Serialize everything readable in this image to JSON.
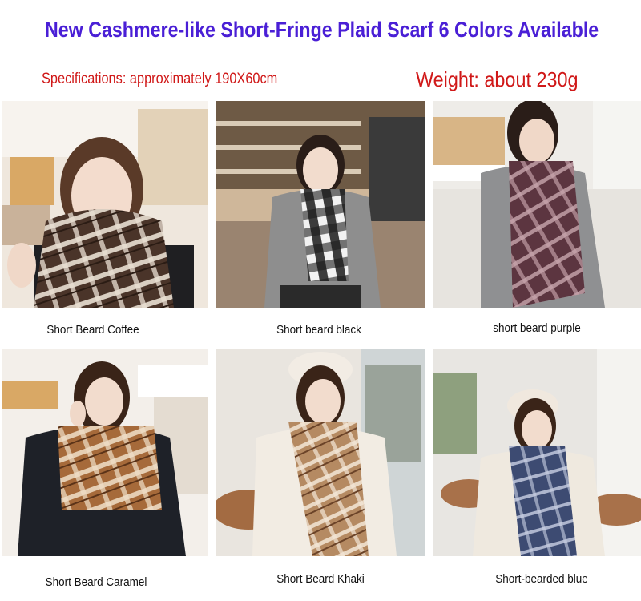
{
  "header": {
    "title": "New Cashmere-like Short-Fringe Plaid Scarf 6 Colors Available",
    "specifications": "Specifications: approximately 190X60cm",
    "weight": "Weight: about 230g"
  },
  "products": [
    {
      "caption": "Short Beard Coffee"
    },
    {
      "caption": "Short beard black"
    },
    {
      "caption": "short beard purple"
    },
    {
      "caption": "Short Beard Caramel"
    },
    {
      "caption": "Short Beard Khaki"
    },
    {
      "caption": "Short-bearded blue"
    }
  ],
  "colors": {
    "title": "#4a1fd6",
    "specs": "#d01818",
    "coffee": "#4a3429",
    "black": "#1c1c1c",
    "purple": "#5c3540",
    "caramel": "#a66a3a",
    "khaki": "#b58a62",
    "blue": "#3d4b72"
  }
}
